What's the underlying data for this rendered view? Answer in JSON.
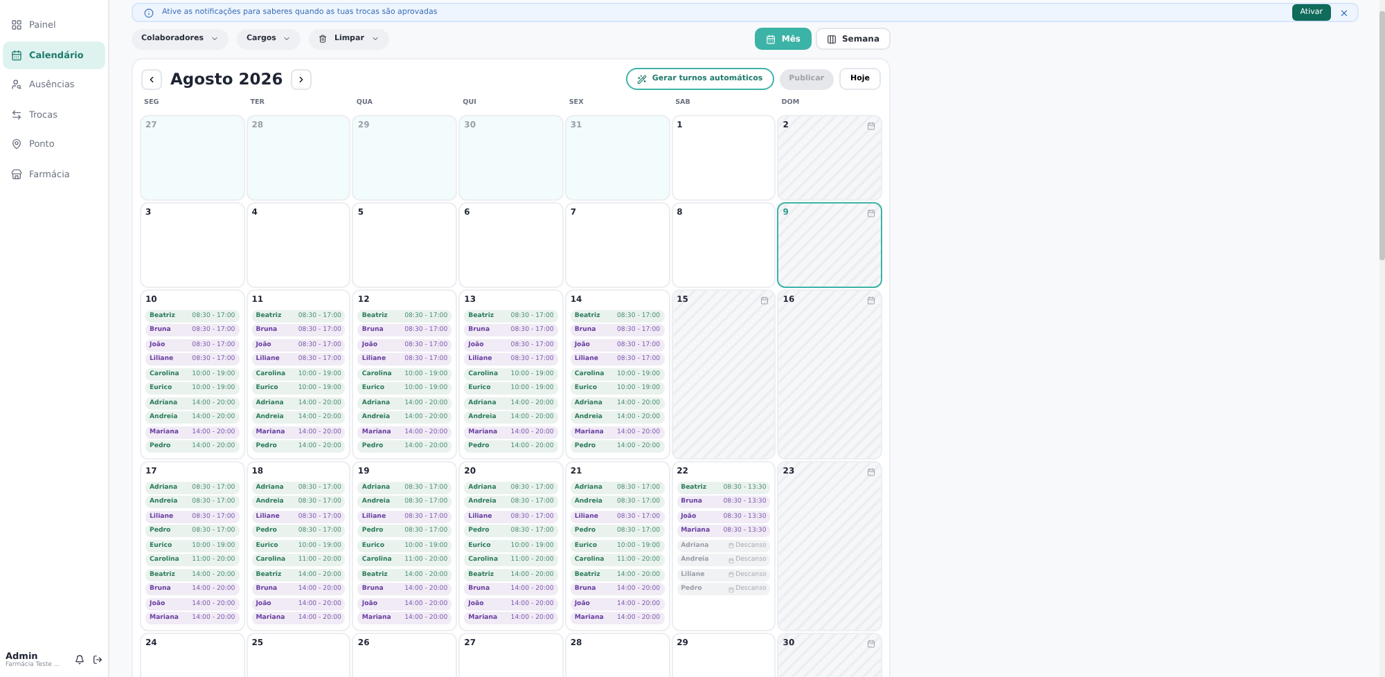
{
  "sidebar": {
    "items": [
      {
        "label": "Painel",
        "selected": false
      },
      {
        "label": "Calendário",
        "selected": true
      },
      {
        "label": "Ausências",
        "selected": false
      },
      {
        "label": "Trocas",
        "selected": false
      },
      {
        "label": "Ponto",
        "selected": false
      },
      {
        "label": "Farmácia",
        "selected": false
      }
    ],
    "user": {
      "name": "Admin",
      "subtitle": "Farmácia Teste ..."
    }
  },
  "banner": {
    "text": "Ative as notificações para saberes quando as tuas trocas são aprovadas",
    "button": "Ativar"
  },
  "filters": [
    {
      "label": "Colaboradores",
      "kind": "plain"
    },
    {
      "label": "Cargos",
      "kind": "plain"
    },
    {
      "label": "Limpar",
      "kind": "clear"
    }
  ],
  "views": [
    {
      "label": "Mês",
      "selected": true
    },
    {
      "label": "Semana",
      "selected": false
    }
  ],
  "calendar": {
    "title": "Agosto 2026",
    "generate_button": "Gerar turnos automáticos",
    "publish_button": {
      "label": "Publicar",
      "disabled": true
    },
    "today_button": "Hoje",
    "weekdays": [
      "SEG",
      "TER",
      "QUA",
      "QUI",
      "SEX",
      "SAB",
      "DOM"
    ],
    "weeks": [
      [
        {
          "day": "27",
          "kind": "outside",
          "today": false
        },
        {
          "day": "28",
          "kind": "outside",
          "today": false
        },
        {
          "day": "29",
          "kind": "outside",
          "today": false
        },
        {
          "day": "30",
          "kind": "outside",
          "today": false
        },
        {
          "day": "31",
          "kind": "outside",
          "today": false
        },
        {
          "day": "1",
          "kind": "open",
          "today": false
        },
        {
          "day": "2",
          "kind": "closed",
          "today": false
        }
      ],
      [
        {
          "day": "3",
          "kind": "open",
          "today": false
        },
        {
          "day": "4",
          "kind": "open",
          "today": false
        },
        {
          "day": "5",
          "kind": "open",
          "today": false
        },
        {
          "day": "6",
          "kind": "open",
          "today": false
        },
        {
          "day": "7",
          "kind": "open",
          "today": false
        },
        {
          "day": "8",
          "kind": "open",
          "today": false
        },
        {
          "day": "9",
          "kind": "closed",
          "today": true
        }
      ],
      [
        {
          "day": "10",
          "kind": "open",
          "today": false,
          "shifts": [
            {
              "kind": "shift",
              "name": "Beatriz",
              "time": "08:30 - 17:00",
              "color": "#2e7d5b"
            },
            {
              "kind": "shift",
              "name": "Bruna",
              "time": "08:30 - 17:00",
              "color": "#6a3fa0"
            },
            {
              "kind": "shift",
              "name": "João",
              "time": "08:30 - 17:00",
              "color": "#6a3fa0"
            },
            {
              "kind": "shift",
              "name": "Liliane",
              "time": "08:30 - 17:00",
              "color": "#6a3fa0"
            },
            {
              "kind": "shift",
              "name": "Carolina",
              "time": "10:00 - 19:00",
              "color": "#2e7d5b"
            },
            {
              "kind": "shift",
              "name": "Eurico",
              "time": "10:00 - 19:00",
              "color": "#2e7d5b"
            },
            {
              "kind": "shift",
              "name": "Adriana",
              "time": "14:00 - 20:00",
              "color": "#2e7d5b"
            },
            {
              "kind": "shift",
              "name": "Andreia",
              "time": "14:00 - 20:00",
              "color": "#2e7d5b"
            },
            {
              "kind": "shift",
              "name": "Mariana",
              "time": "14:00 - 20:00",
              "color": "#6a3fa0"
            },
            {
              "kind": "shift",
              "name": "Pedro",
              "time": "14:00 - 20:00",
              "color": "#2e7d5b"
            }
          ]
        },
        {
          "day": "11",
          "kind": "open",
          "today": false,
          "shifts": [
            {
              "kind": "shift",
              "name": "Beatriz",
              "time": "08:30 - 17:00",
              "color": "#2e7d5b"
            },
            {
              "kind": "shift",
              "name": "Bruna",
              "time": "08:30 - 17:00",
              "color": "#6a3fa0"
            },
            {
              "kind": "shift",
              "name": "João",
              "time": "08:30 - 17:00",
              "color": "#6a3fa0"
            },
            {
              "kind": "shift",
              "name": "Liliane",
              "time": "08:30 - 17:00",
              "color": "#6a3fa0"
            },
            {
              "kind": "shift",
              "name": "Carolina",
              "time": "10:00 - 19:00",
              "color": "#2e7d5b"
            },
            {
              "kind": "shift",
              "name": "Eurico",
              "time": "10:00 - 19:00",
              "color": "#2e7d5b"
            },
            {
              "kind": "shift",
              "name": "Adriana",
              "time": "14:00 - 20:00",
              "color": "#2e7d5b"
            },
            {
              "kind": "shift",
              "name": "Andreia",
              "time": "14:00 - 20:00",
              "color": "#2e7d5b"
            },
            {
              "kind": "shift",
              "name": "Mariana",
              "time": "14:00 - 20:00",
              "color": "#6a3fa0"
            },
            {
              "kind": "shift",
              "name": "Pedro",
              "time": "14:00 - 20:00",
              "color": "#2e7d5b"
            }
          ]
        },
        {
          "day": "12",
          "kind": "open",
          "today": false,
          "shifts": [
            {
              "kind": "shift",
              "name": "Beatriz",
              "time": "08:30 - 17:00",
              "color": "#2e7d5b"
            },
            {
              "kind": "shift",
              "name": "Bruna",
              "time": "08:30 - 17:00",
              "color": "#6a3fa0"
            },
            {
              "kind": "shift",
              "name": "João",
              "time": "08:30 - 17:00",
              "color": "#6a3fa0"
            },
            {
              "kind": "shift",
              "name": "Liliane",
              "time": "08:30 - 17:00",
              "color": "#6a3fa0"
            },
            {
              "kind": "shift",
              "name": "Carolina",
              "time": "10:00 - 19:00",
              "color": "#2e7d5b"
            },
            {
              "kind": "shift",
              "name": "Eurico",
              "time": "10:00 - 19:00",
              "color": "#2e7d5b"
            },
            {
              "kind": "shift",
              "name": "Adriana",
              "time": "14:00 - 20:00",
              "color": "#2e7d5b"
            },
            {
              "kind": "shift",
              "name": "Andreia",
              "time": "14:00 - 20:00",
              "color": "#2e7d5b"
            },
            {
              "kind": "shift",
              "name": "Mariana",
              "time": "14:00 - 20:00",
              "color": "#6a3fa0"
            },
            {
              "kind": "shift",
              "name": "Pedro",
              "time": "14:00 - 20:00",
              "color": "#2e7d5b"
            }
          ]
        },
        {
          "day": "13",
          "kind": "open",
          "today": false,
          "shifts": [
            {
              "kind": "shift",
              "name": "Beatriz",
              "time": "08:30 - 17:00",
              "color": "#2e7d5b"
            },
            {
              "kind": "shift",
              "name": "Bruna",
              "time": "08:30 - 17:00",
              "color": "#6a3fa0"
            },
            {
              "kind": "shift",
              "name": "João",
              "time": "08:30 - 17:00",
              "color": "#6a3fa0"
            },
            {
              "kind": "shift",
              "name": "Liliane",
              "time": "08:30 - 17:00",
              "color": "#6a3fa0"
            },
            {
              "kind": "shift",
              "name": "Carolina",
              "time": "10:00 - 19:00",
              "color": "#2e7d5b"
            },
            {
              "kind": "shift",
              "name": "Eurico",
              "time": "10:00 - 19:00",
              "color": "#2e7d5b"
            },
            {
              "kind": "shift",
              "name": "Adriana",
              "time": "14:00 - 20:00",
              "color": "#2e7d5b"
            },
            {
              "kind": "shift",
              "name": "Andreia",
              "time": "14:00 - 20:00",
              "color": "#2e7d5b"
            },
            {
              "kind": "shift",
              "name": "Mariana",
              "time": "14:00 - 20:00",
              "color": "#6a3fa0"
            },
            {
              "kind": "shift",
              "name": "Pedro",
              "time": "14:00 - 20:00",
              "color": "#2e7d5b"
            }
          ]
        },
        {
          "day": "14",
          "kind": "open",
          "today": false,
          "shifts": [
            {
              "kind": "shift",
              "name": "Beatriz",
              "time": "08:30 - 17:00",
              "color": "#2e7d5b"
            },
            {
              "kind": "shift",
              "name": "Bruna",
              "time": "08:30 - 17:00",
              "color": "#6a3fa0"
            },
            {
              "kind": "shift",
              "name": "João",
              "time": "08:30 - 17:00",
              "color": "#6a3fa0"
            },
            {
              "kind": "shift",
              "name": "Liliane",
              "time": "08:30 - 17:00",
              "color": "#6a3fa0"
            },
            {
              "kind": "shift",
              "name": "Carolina",
              "time": "10:00 - 19:00",
              "color": "#2e7d5b"
            },
            {
              "kind": "shift",
              "name": "Eurico",
              "time": "10:00 - 19:00",
              "color": "#2e7d5b"
            },
            {
              "kind": "shift",
              "name": "Adriana",
              "time": "14:00 - 20:00",
              "color": "#2e7d5b"
            },
            {
              "kind": "shift",
              "name": "Andreia",
              "time": "14:00 - 20:00",
              "color": "#2e7d5b"
            },
            {
              "kind": "shift",
              "name": "Mariana",
              "time": "14:00 - 20:00",
              "color": "#6a3fa0"
            },
            {
              "kind": "shift",
              "name": "Pedro",
              "time": "14:00 - 20:00",
              "color": "#2e7d5b"
            }
          ]
        },
        {
          "day": "15",
          "kind": "closed",
          "today": false
        },
        {
          "day": "16",
          "kind": "closed",
          "today": false
        }
      ],
      [
        {
          "day": "17",
          "kind": "open",
          "today": false,
          "shifts": [
            {
              "kind": "shift",
              "name": "Adriana",
              "time": "08:30 - 17:00",
              "color": "#2e7d5b"
            },
            {
              "kind": "shift",
              "name": "Andreia",
              "time": "08:30 - 17:00",
              "color": "#2e7d5b"
            },
            {
              "kind": "shift",
              "name": "Liliane",
              "time": "08:30 - 17:00",
              "color": "#6a3fa0"
            },
            {
              "kind": "shift",
              "name": "Pedro",
              "time": "08:30 - 17:00",
              "color": "#2e7d5b"
            },
            {
              "kind": "shift",
              "name": "Eurico",
              "time": "10:00 - 19:00",
              "color": "#2e7d5b"
            },
            {
              "kind": "shift",
              "name": "Carolina",
              "time": "11:00 - 20:00",
              "color": "#2e7d5b"
            },
            {
              "kind": "shift",
              "name": "Beatriz",
              "time": "14:00 - 20:00",
              "color": "#2e7d5b"
            },
            {
              "kind": "shift",
              "name": "Bruna",
              "time": "14:00 - 20:00",
              "color": "#6a3fa0"
            },
            {
              "kind": "shift",
              "name": "João",
              "time": "14:00 - 20:00",
              "color": "#6a3fa0"
            },
            {
              "kind": "shift",
              "name": "Mariana",
              "time": "14:00 - 20:00",
              "color": "#6a3fa0"
            }
          ]
        },
        {
          "day": "18",
          "kind": "open",
          "today": false,
          "shifts": [
            {
              "kind": "shift",
              "name": "Adriana",
              "time": "08:30 - 17:00",
              "color": "#2e7d5b"
            },
            {
              "kind": "shift",
              "name": "Andreia",
              "time": "08:30 - 17:00",
              "color": "#2e7d5b"
            },
            {
              "kind": "shift",
              "name": "Liliane",
              "time": "08:30 - 17:00",
              "color": "#6a3fa0"
            },
            {
              "kind": "shift",
              "name": "Pedro",
              "time": "08:30 - 17:00",
              "color": "#2e7d5b"
            },
            {
              "kind": "shift",
              "name": "Eurico",
              "time": "10:00 - 19:00",
              "color": "#2e7d5b"
            },
            {
              "kind": "shift",
              "name": "Carolina",
              "time": "11:00 - 20:00",
              "color": "#2e7d5b"
            },
            {
              "kind": "shift",
              "name": "Beatriz",
              "time": "14:00 - 20:00",
              "color": "#2e7d5b"
            },
            {
              "kind": "shift",
              "name": "Bruna",
              "time": "14:00 - 20:00",
              "color": "#6a3fa0"
            },
            {
              "kind": "shift",
              "name": "João",
              "time": "14:00 - 20:00",
              "color": "#6a3fa0"
            },
            {
              "kind": "shift",
              "name": "Mariana",
              "time": "14:00 - 20:00",
              "color": "#6a3fa0"
            }
          ]
        },
        {
          "day": "19",
          "kind": "open",
          "today": false,
          "shifts": [
            {
              "kind": "shift",
              "name": "Adriana",
              "time": "08:30 - 17:00",
              "color": "#2e7d5b"
            },
            {
              "kind": "shift",
              "name": "Andreia",
              "time": "08:30 - 17:00",
              "color": "#2e7d5b"
            },
            {
              "kind": "shift",
              "name": "Liliane",
              "time": "08:30 - 17:00",
              "color": "#6a3fa0"
            },
            {
              "kind": "shift",
              "name": "Pedro",
              "time": "08:30 - 17:00",
              "color": "#2e7d5b"
            },
            {
              "kind": "shift",
              "name": "Eurico",
              "time": "10:00 - 19:00",
              "color": "#2e7d5b"
            },
            {
              "kind": "shift",
              "name": "Carolina",
              "time": "11:00 - 20:00",
              "color": "#2e7d5b"
            },
            {
              "kind": "shift",
              "name": "Beatriz",
              "time": "14:00 - 20:00",
              "color": "#2e7d5b"
            },
            {
              "kind": "shift",
              "name": "Bruna",
              "time": "14:00 - 20:00",
              "color": "#6a3fa0"
            },
            {
              "kind": "shift",
              "name": "João",
              "time": "14:00 - 20:00",
              "color": "#6a3fa0"
            },
            {
              "kind": "shift",
              "name": "Mariana",
              "time": "14:00 - 20:00",
              "color": "#6a3fa0"
            }
          ]
        },
        {
          "day": "20",
          "kind": "open",
          "today": false,
          "shifts": [
            {
              "kind": "shift",
              "name": "Adriana",
              "time": "08:30 - 17:00",
              "color": "#2e7d5b"
            },
            {
              "kind": "shift",
              "name": "Andreia",
              "time": "08:30 - 17:00",
              "color": "#2e7d5b"
            },
            {
              "kind": "shift",
              "name": "Liliane",
              "time": "08:30 - 17:00",
              "color": "#6a3fa0"
            },
            {
              "kind": "shift",
              "name": "Pedro",
              "time": "08:30 - 17:00",
              "color": "#2e7d5b"
            },
            {
              "kind": "shift",
              "name": "Eurico",
              "time": "10:00 - 19:00",
              "color": "#2e7d5b"
            },
            {
              "kind": "shift",
              "name": "Carolina",
              "time": "11:00 - 20:00",
              "color": "#2e7d5b"
            },
            {
              "kind": "shift",
              "name": "Beatriz",
              "time": "14:00 - 20:00",
              "color": "#2e7d5b"
            },
            {
              "kind": "shift",
              "name": "Bruna",
              "time": "14:00 - 20:00",
              "color": "#6a3fa0"
            },
            {
              "kind": "shift",
              "name": "João",
              "time": "14:00 - 20:00",
              "color": "#6a3fa0"
            },
            {
              "kind": "shift",
              "name": "Mariana",
              "time": "14:00 - 20:00",
              "color": "#6a3fa0"
            }
          ]
        },
        {
          "day": "21",
          "kind": "open",
          "today": false,
          "shifts": [
            {
              "kind": "shift",
              "name": "Adriana",
              "time": "08:30 - 17:00",
              "color": "#2e7d5b"
            },
            {
              "kind": "shift",
              "name": "Andreia",
              "time": "08:30 - 17:00",
              "color": "#2e7d5b"
            },
            {
              "kind": "shift",
              "name": "Liliane",
              "time": "08:30 - 17:00",
              "color": "#6a3fa0"
            },
            {
              "kind": "shift",
              "name": "Pedro",
              "time": "08:30 - 17:00",
              "color": "#2e7d5b"
            },
            {
              "kind": "shift",
              "name": "Eurico",
              "time": "10:00 - 19:00",
              "color": "#2e7d5b"
            },
            {
              "kind": "shift",
              "name": "Carolina",
              "time": "11:00 - 20:00",
              "color": "#2e7d5b"
            },
            {
              "kind": "shift",
              "name": "Beatriz",
              "time": "14:00 - 20:00",
              "color": "#2e7d5b"
            },
            {
              "kind": "shift",
              "name": "Bruna",
              "time": "14:00 - 20:00",
              "color": "#6a3fa0"
            },
            {
              "kind": "shift",
              "name": "João",
              "time": "14:00 - 20:00",
              "color": "#6a3fa0"
            },
            {
              "kind": "shift",
              "name": "Mariana",
              "time": "14:00 - 20:00",
              "color": "#6a3fa0"
            }
          ]
        },
        {
          "day": "22",
          "kind": "open",
          "today": false,
          "shifts": [
            {
              "kind": "shift",
              "name": "Beatriz",
              "time": "08:30 - 13:30",
              "color": "#2e7d5b"
            },
            {
              "kind": "shift",
              "name": "Bruna",
              "time": "08:30 - 13:30",
              "color": "#6a3fa0"
            },
            {
              "kind": "shift",
              "name": "João",
              "time": "08:30 - 13:30",
              "color": "#6a3fa0"
            },
            {
              "kind": "shift",
              "name": "Mariana",
              "time": "08:30 - 13:30",
              "color": "#6a3fa0"
            },
            {
              "kind": "rest",
              "name": "Adriana",
              "time": "Descanso"
            },
            {
              "kind": "rest",
              "name": "Andreia",
              "time": "Descanso"
            },
            {
              "kind": "rest",
              "name": "Liliane",
              "time": "Descanso"
            },
            {
              "kind": "rest",
              "name": "Pedro",
              "time": "Descanso"
            }
          ]
        },
        {
          "day": "23",
          "kind": "closed",
          "today": false
        }
      ],
      [
        {
          "day": "24",
          "kind": "open",
          "today": false
        },
        {
          "day": "25",
          "kind": "open",
          "today": false
        },
        {
          "day": "26",
          "kind": "open",
          "today": false
        },
        {
          "day": "27",
          "kind": "open",
          "today": false
        },
        {
          "day": "28",
          "kind": "open",
          "today": false
        },
        {
          "day": "29",
          "kind": "open",
          "today": false
        },
        {
          "day": "30",
          "kind": "closed",
          "today": false
        }
      ]
    ]
  }
}
